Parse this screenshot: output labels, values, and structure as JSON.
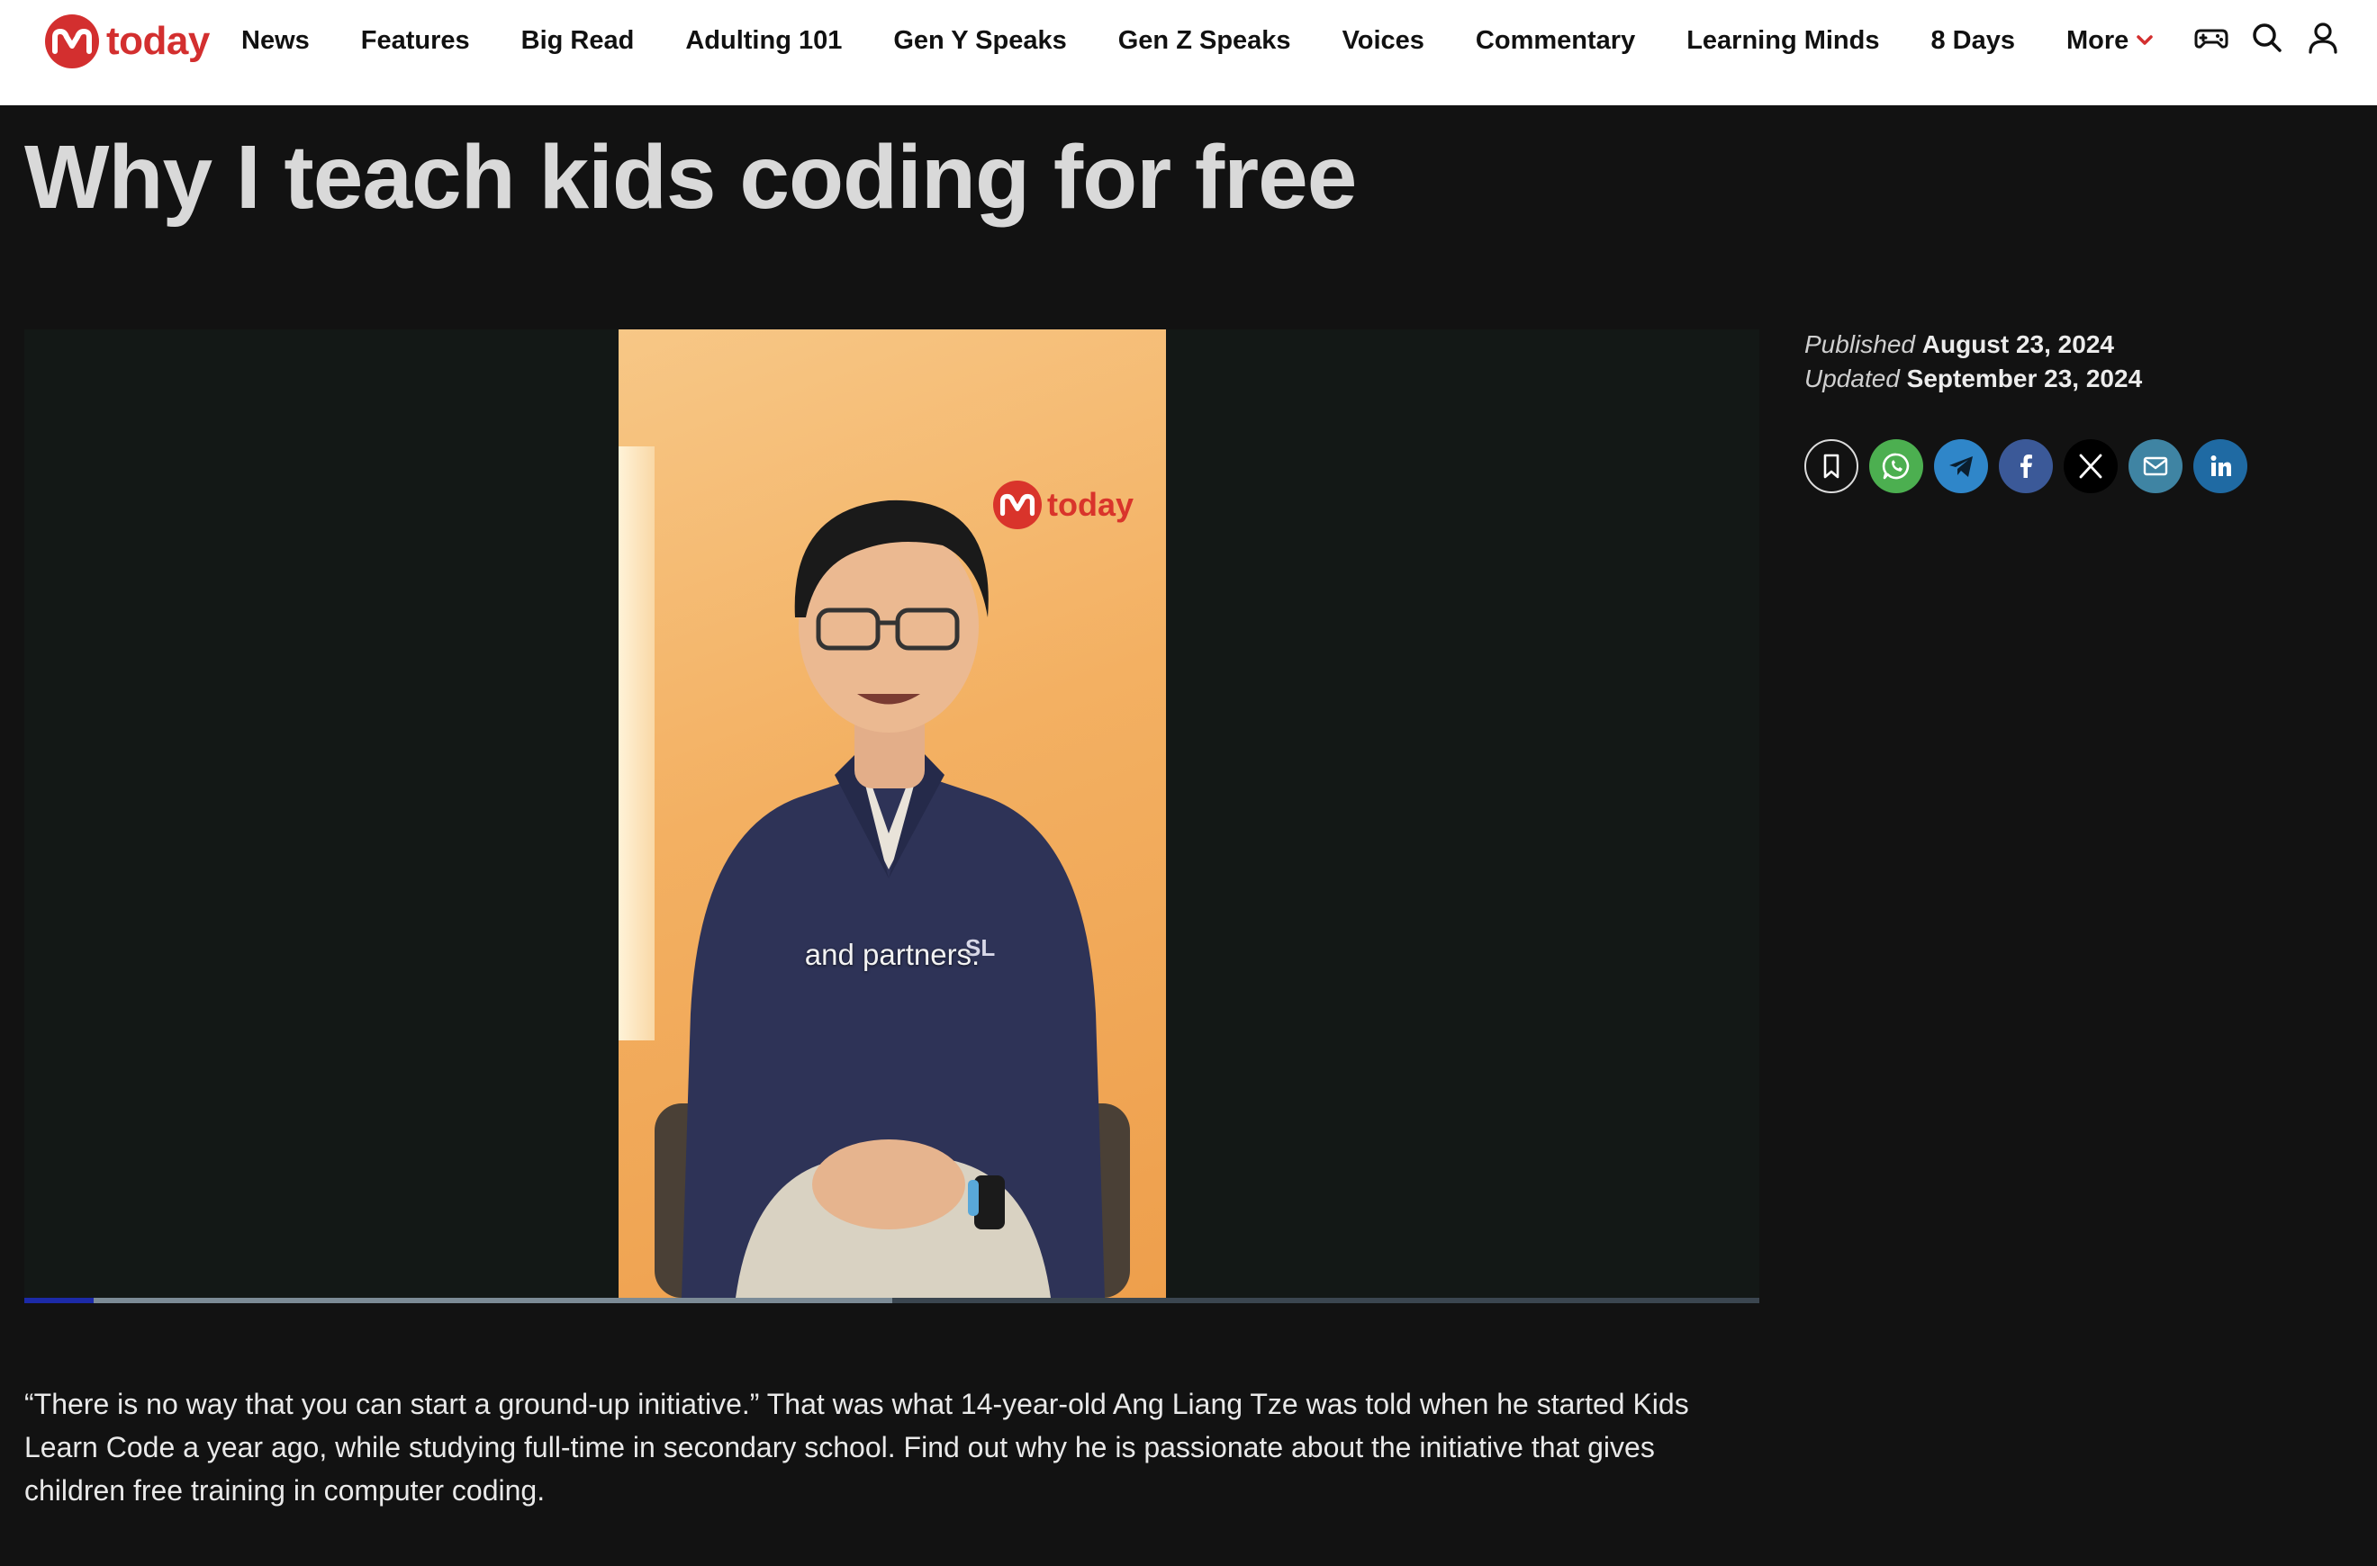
{
  "header": {
    "logo_text": "today",
    "nav_items": [
      "News",
      "Features",
      "Big Read",
      "Adulting 101",
      "Gen Y Speaks",
      "Gen Z Speaks",
      "Voices",
      "Commentary",
      "Learning Minds",
      "8 Days"
    ],
    "more_label": "More",
    "icons": [
      "gamepad-icon",
      "search-icon",
      "user-icon"
    ],
    "accent_color": "#d32f2f"
  },
  "article": {
    "title": "Why I teach kids coding for free",
    "published_label": "Published",
    "published_date": "August 23, 2024",
    "updated_label": "Updated",
    "updated_date": "September 23, 2024",
    "lede": "“There is no way that you can start a ground-up initiative.” That was what 14-year-old Ang Liang Tze was told when he started Kids Learn Code a year ago, while studying full-time in secondary school. Find out why he is passionate about the initiative that gives children free training in computer coding."
  },
  "video": {
    "watermark_text": "today",
    "caption": "and partners.",
    "progress_played": 0.04,
    "progress_buffered": 0.5
  },
  "share": {
    "buttons": [
      {
        "name": "bookmark",
        "icon": "bookmark-icon",
        "color": "transparent"
      },
      {
        "name": "whatsapp",
        "icon": "whatsapp-icon",
        "color": "#4caf50"
      },
      {
        "name": "telegram",
        "icon": "telegram-icon",
        "color": "#2f86c9"
      },
      {
        "name": "facebook",
        "icon": "facebook-icon",
        "color": "#3b5998"
      },
      {
        "name": "x",
        "icon": "x-icon",
        "color": "#000000"
      },
      {
        "name": "email",
        "icon": "email-icon",
        "color": "#3f84a3"
      },
      {
        "name": "linkedin",
        "icon": "linkedin-icon",
        "color": "#1f6aa3"
      }
    ]
  }
}
